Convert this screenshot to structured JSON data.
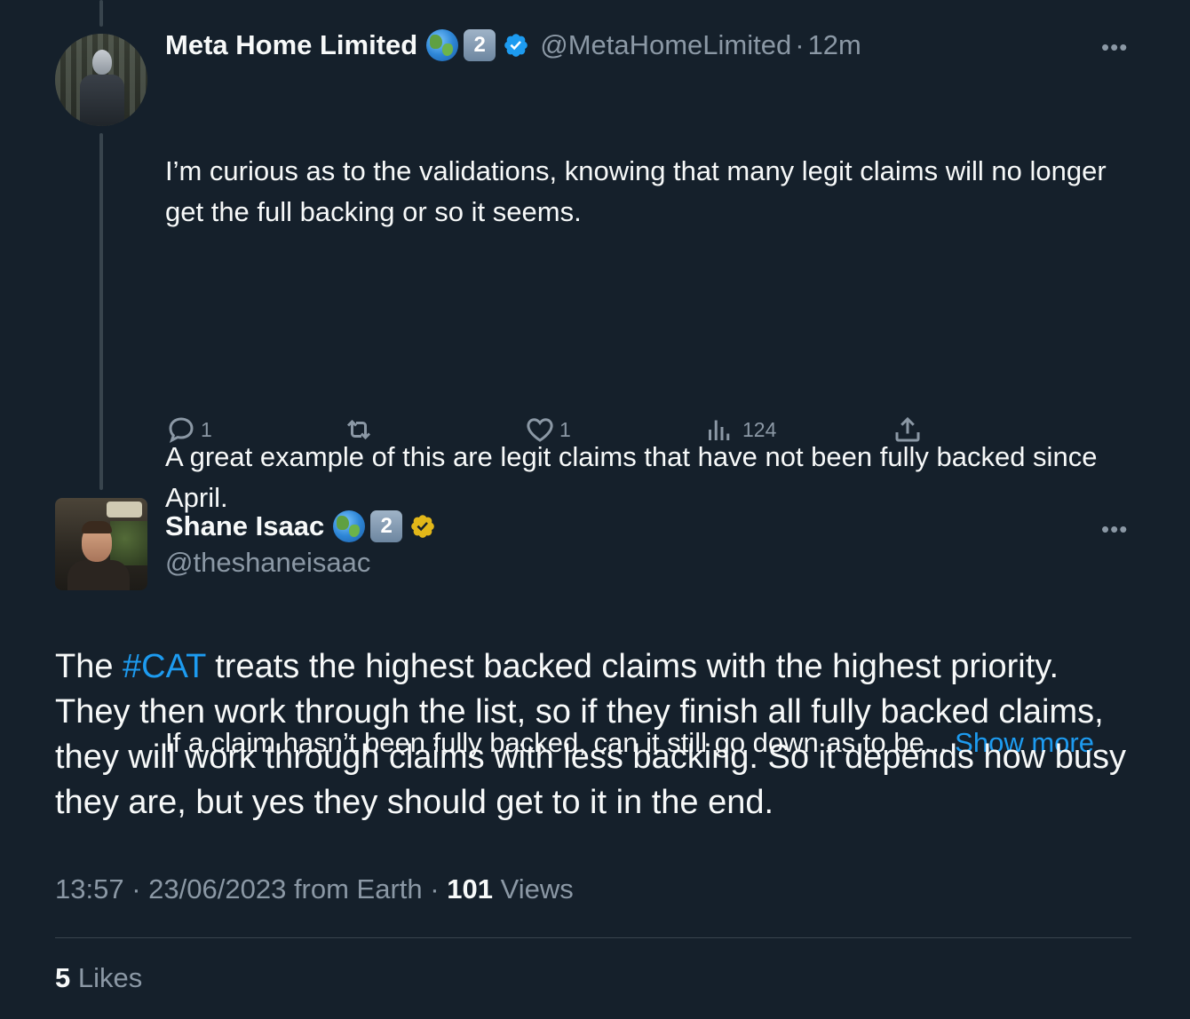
{
  "colors": {
    "background": "#15202b",
    "text_primary": "#f7f9f9",
    "text_secondary": "#8b98a5",
    "link": "#1d9bf0",
    "verified_blue": "#1d9bf0",
    "verified_gold": "#e2b719"
  },
  "parent_tweet": {
    "display_name": "Meta Home Limited",
    "badges": [
      "globe-icon",
      "keycap-2-icon",
      "verified-blue-icon"
    ],
    "keycap_text": "2",
    "handle": "@MetaHomeLimited",
    "separator": "·",
    "time": "12m",
    "more_icon": "more-horizontal-icon",
    "paragraph_1": "I’m curious as to the validations, knowing that many legit claims will no longer get the full backing or so it seems.",
    "paragraph_2": "A great example of this are legit claims that have not been fully backed since April.",
    "paragraph_3": "If a claim hasn’t been fully backed, can it still go down as to be... ",
    "show_more": "Show more",
    "actions": {
      "reply_count": "1",
      "retweet_count": "",
      "like_count": "1",
      "views_count": "124"
    }
  },
  "main_tweet": {
    "display_name": "Shane Isaac",
    "badges": [
      "globe-icon",
      "keycap-2-icon",
      "verified-gold-icon"
    ],
    "keycap_text": "2",
    "handle": "@theshaneisaac",
    "more_icon": "more-horizontal-icon",
    "text_before": "The ",
    "hashtag": "#CAT",
    "text_after": " treats the highest backed claims with the highest priority. They then work through the list, so if they finish all fully backed claims, they will work through claims with less backing. So it depends how busy they are, but yes they should get to it in the end.",
    "time": "13:57",
    "date": "23/06/2023",
    "source": "from Earth",
    "separator": "·",
    "views_count": "101",
    "views_label": "Views",
    "likes_count": "5",
    "likes_label": "Likes"
  }
}
